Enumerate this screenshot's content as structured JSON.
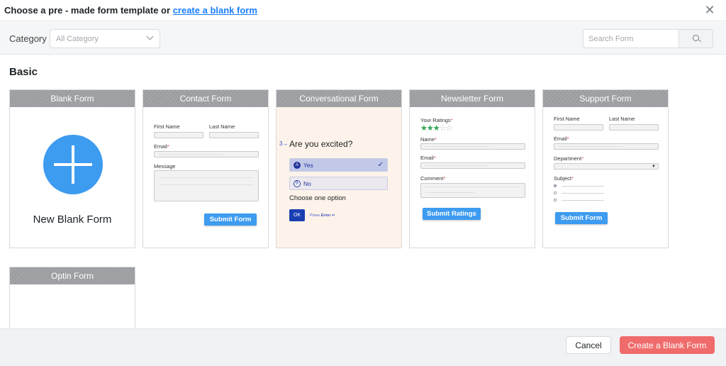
{
  "header": {
    "title_prefix": "Choose a pre - made form template or",
    "title_link": "create a blank form",
    "close_glyph": "✕"
  },
  "filter": {
    "category_label": "Category",
    "category_value": "All Category",
    "search_placeholder": "Search Form"
  },
  "section": {
    "title": "Basic"
  },
  "cards": {
    "blank": {
      "title": "Blank Form",
      "label": "New Blank Form"
    },
    "contact": {
      "title": "Contact Form",
      "first_name": "First Name",
      "last_name": "Last Name",
      "email": "Email",
      "message": "Message",
      "submit": "Submit Form"
    },
    "conversational": {
      "title": "Conversational Form",
      "number": "3→",
      "question": "Are you excited?",
      "option_yes_key": "A",
      "option_yes": "Yes",
      "option_no_key": "B",
      "option_no": "No",
      "choose": "Choose one option",
      "ok": "OK",
      "press": "Press",
      "enter": "Enter ↵"
    },
    "newsletter": {
      "title": "Newsletter Form",
      "ratings": "Your Ratings",
      "stars_filled": 3,
      "stars_total": 5,
      "name": "Name",
      "email": "Email",
      "comment": "Comment",
      "submit": "Submit Ratings"
    },
    "support": {
      "title": "Support Form",
      "first_name": "First Name",
      "last_name": "Last Name",
      "email": "Email",
      "department": "Department",
      "subject": "Subject",
      "submit": "Submit Form"
    },
    "optin": {
      "title": "Optin Form"
    }
  },
  "footer": {
    "cancel": "Cancel",
    "create": "Create a Blank Form"
  },
  "colors": {
    "accent": "#1a7efb",
    "submit_blue": "#3d9bf0",
    "create_button": "#f06c6c",
    "star_green": "#2ea44f"
  }
}
